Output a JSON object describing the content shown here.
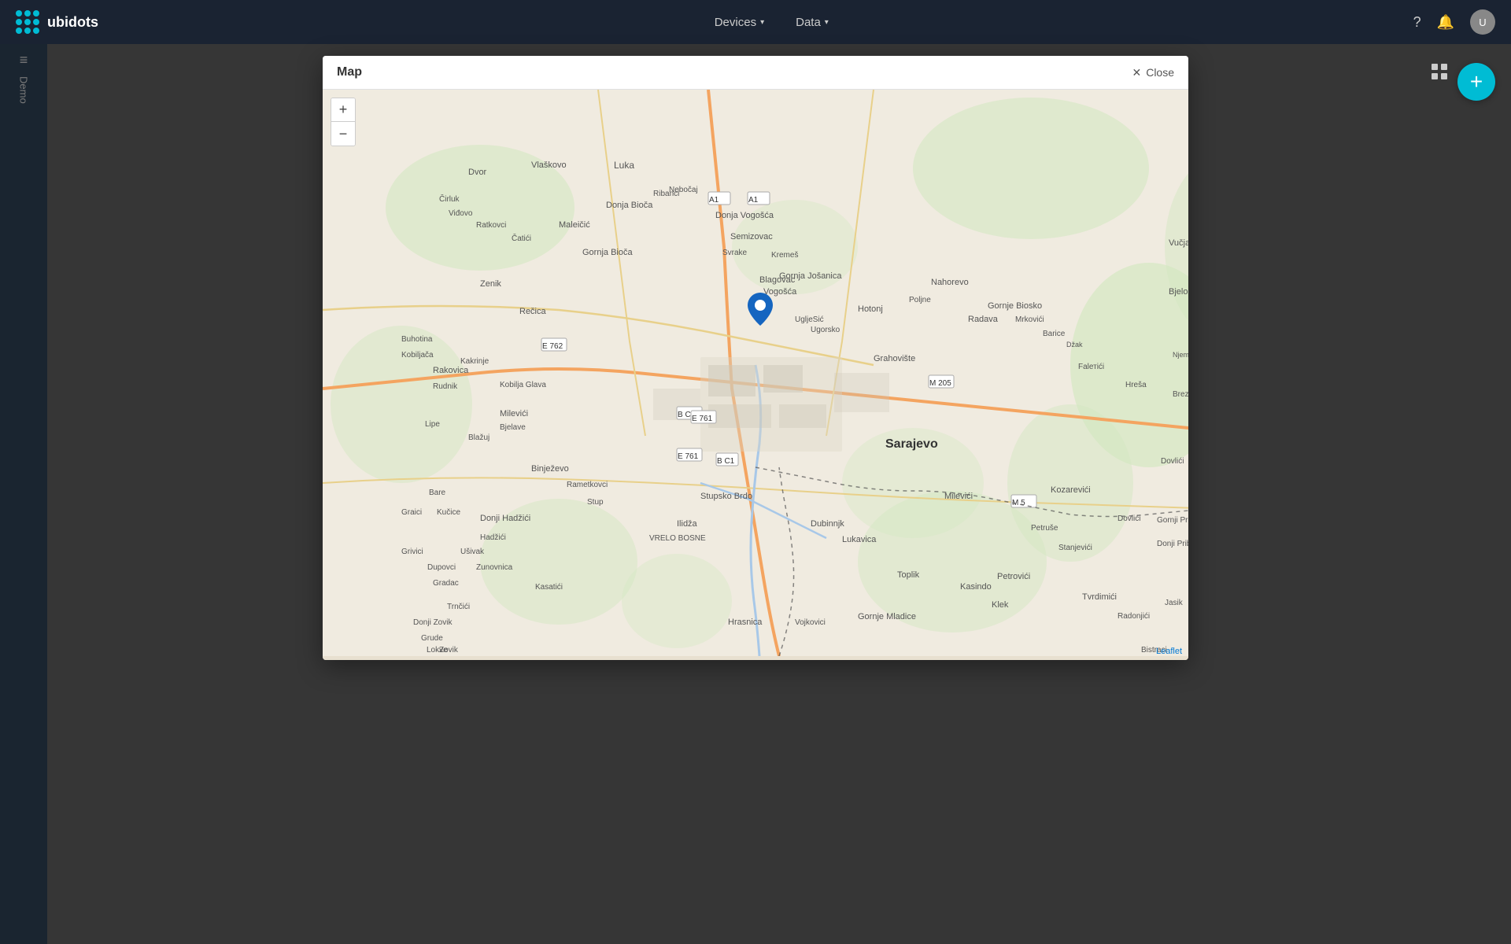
{
  "navbar": {
    "brand": "ubidots",
    "nav_items": [
      {
        "label": "Devices",
        "arrow": "▾"
      },
      {
        "label": "Data",
        "arrow": "▾"
      }
    ],
    "help_icon": "?",
    "bell_icon": "🔔",
    "avatar_text": "U"
  },
  "sidebar": {
    "menu_icon": "≡",
    "title": "Demo"
  },
  "modal": {
    "title": "Map",
    "close_label": "Close",
    "zoom_in": "+",
    "zoom_out": "−",
    "attribution": "Leaflet"
  },
  "map": {
    "city_label": "Sarajevo",
    "pin_lat": 43.848,
    "pin_lng": 18.356
  },
  "add_button": "+"
}
